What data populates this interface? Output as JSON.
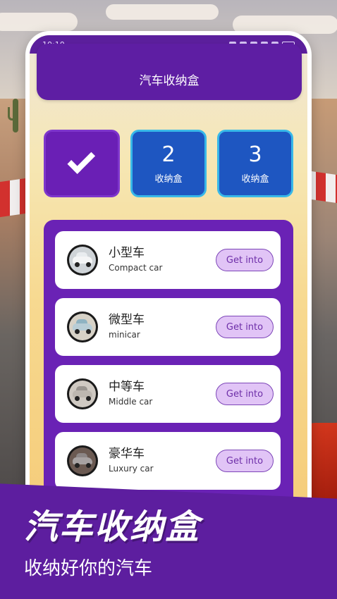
{
  "status_bar": {
    "time": "10:10"
  },
  "header": {
    "title": "汽车收纳盒"
  },
  "tiles": [
    {
      "icon": "check-icon",
      "selected": true
    },
    {
      "number": "2",
      "label": "收纳盒"
    },
    {
      "number": "3",
      "label": "收纳盒"
    }
  ],
  "cars": [
    {
      "name_cn": "小型车",
      "name_en": "Compact car",
      "button": "Get into",
      "icon": "compact-car-icon"
    },
    {
      "name_cn": "微型车",
      "name_en": "minicar",
      "button": "Get into",
      "icon": "minicar-icon"
    },
    {
      "name_cn": "中等车",
      "name_en": "Middle car",
      "button": "Get into",
      "icon": "middle-car-icon"
    },
    {
      "name_cn": "豪华车",
      "name_en": "Luxury car",
      "button": "Get into",
      "icon": "luxury-car-icon"
    }
  ],
  "banner": {
    "title": "汽车收纳盒",
    "subtitle": "收纳好你的汽车"
  },
  "colors": {
    "primary_purple": "#5e1ea3",
    "tile_blue": "#1e56c1",
    "tile_border_blue": "#38b8e8",
    "button_bg": "#e1c4f6"
  }
}
